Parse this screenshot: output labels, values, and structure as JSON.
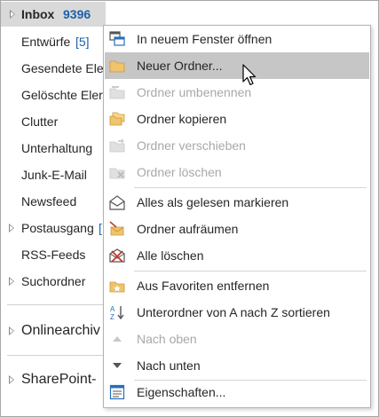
{
  "folder_pane": {
    "inbox": {
      "label": "Inbox",
      "count": "9396"
    },
    "items": [
      {
        "label": "Entwürfe",
        "count": "[5]"
      },
      {
        "label": "Gesendete Ele"
      },
      {
        "label": "Gelöschte Eler"
      },
      {
        "label": "Clutter"
      },
      {
        "label": "Unterhaltung"
      },
      {
        "label": "Junk-E-Mail"
      },
      {
        "label": "Newsfeed"
      },
      {
        "label": "Postausgang",
        "count": "["
      },
      {
        "label": "RSS-Feeds"
      },
      {
        "label": "Suchordner"
      }
    ],
    "groups": [
      {
        "label": "Onlinearchiv"
      },
      {
        "label": "SharePoint-"
      }
    ]
  },
  "context_menu": {
    "items": [
      {
        "label": "In neuem Fenster öffnen",
        "icon": "new-window-icon",
        "disabled": false
      },
      {
        "label": "Neuer Ordner...",
        "icon": "new-folder-icon",
        "disabled": false,
        "highlighted": true
      },
      {
        "label": "Ordner umbenennen",
        "icon": "rename-folder-icon",
        "disabled": true
      },
      {
        "label": "Ordner kopieren",
        "icon": "copy-folder-icon",
        "disabled": false
      },
      {
        "label": "Ordner verschieben",
        "icon": "move-folder-icon",
        "disabled": true
      },
      {
        "label": "Ordner löschen",
        "icon": "delete-folder-icon",
        "disabled": true
      },
      {
        "label": "Alles als gelesen markieren",
        "icon": "mark-read-icon",
        "disabled": false
      },
      {
        "label": "Ordner aufräumen",
        "icon": "clean-up-icon",
        "disabled": false
      },
      {
        "label": "Alle löschen",
        "icon": "delete-all-icon",
        "disabled": false
      },
      {
        "label": "Aus Favoriten entfernen",
        "icon": "remove-favorite-icon",
        "disabled": false
      },
      {
        "label": "Unterordner von A nach Z sortieren",
        "icon": "sort-az-icon",
        "disabled": false
      },
      {
        "label": "Nach oben",
        "icon": "move-up-icon",
        "disabled": true
      },
      {
        "label": "Nach unten",
        "icon": "move-down-icon",
        "disabled": false
      },
      {
        "label": "Eigenschaften...",
        "icon": "properties-icon",
        "disabled": false
      }
    ]
  },
  "colors": {
    "accent": "#1e5fa8",
    "folder": "#f0c36d",
    "highlight": "#c6c6c6",
    "disabled": "#a8a8a8",
    "delete_red": "#c0392b"
  }
}
